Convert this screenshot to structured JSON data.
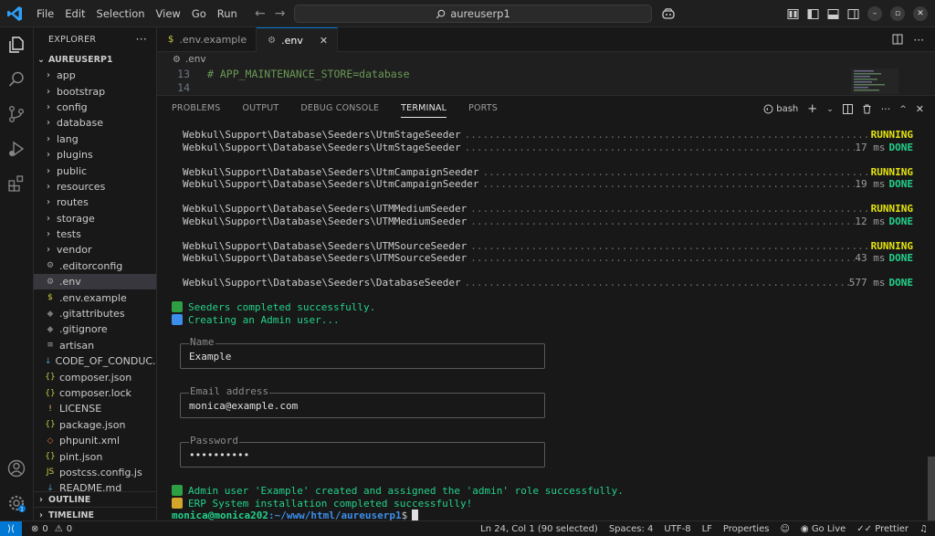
{
  "titlebar": {
    "menu": [
      "File",
      "Edit",
      "Selection",
      "View",
      "Go",
      "Run"
    ],
    "search": "aureuserp1"
  },
  "explorer": {
    "title": "EXPLORER",
    "more": "···",
    "root": "AUREUSERP1",
    "items": [
      {
        "label": "app",
        "type": "folder"
      },
      {
        "label": "bootstrap",
        "type": "folder"
      },
      {
        "label": "config",
        "type": "folder"
      },
      {
        "label": "database",
        "type": "folder"
      },
      {
        "label": "lang",
        "type": "folder"
      },
      {
        "label": "plugins",
        "type": "folder"
      },
      {
        "label": "public",
        "type": "folder"
      },
      {
        "label": "resources",
        "type": "folder"
      },
      {
        "label": "routes",
        "type": "folder"
      },
      {
        "label": "storage",
        "type": "folder"
      },
      {
        "label": "tests",
        "type": "folder"
      },
      {
        "label": "vendor",
        "type": "folder"
      },
      {
        "label": ".editorconfig",
        "type": "file",
        "icon": "⚙",
        "color": "#a0a0a0"
      },
      {
        "label": ".env",
        "type": "file",
        "icon": "⚙",
        "color": "#a0a0a0",
        "selected": true
      },
      {
        "label": ".env.example",
        "type": "file",
        "icon": "$",
        "color": "#cbcb41"
      },
      {
        "label": ".gitattributes",
        "type": "file",
        "icon": "◆",
        "color": "#7a7a7a"
      },
      {
        "label": ".gitignore",
        "type": "file",
        "icon": "◆",
        "color": "#7a7a7a"
      },
      {
        "label": "artisan",
        "type": "file",
        "icon": "≡",
        "color": "#a0a0a0"
      },
      {
        "label": "CODE_OF_CONDUC...",
        "type": "file",
        "icon": "↓",
        "color": "#519aba"
      },
      {
        "label": "composer.json",
        "type": "file",
        "icon": "{}",
        "color": "#cbcb41"
      },
      {
        "label": "composer.lock",
        "type": "file",
        "icon": "{}",
        "color": "#cbcb41"
      },
      {
        "label": "LICENSE",
        "type": "file",
        "icon": "!",
        "color": "#e5c07b"
      },
      {
        "label": "package.json",
        "type": "file",
        "icon": "{}",
        "color": "#cbcb41"
      },
      {
        "label": "phpunit.xml",
        "type": "file",
        "icon": "◇",
        "color": "#e37933"
      },
      {
        "label": "pint.json",
        "type": "file",
        "icon": "{}",
        "color": "#cbcb41"
      },
      {
        "label": "postcss.config.js",
        "type": "file",
        "icon": "JS",
        "color": "#cbcb41"
      },
      {
        "label": "README.md",
        "type": "file",
        "icon": "↓",
        "color": "#519aba"
      }
    ],
    "outline": "OUTLINE",
    "timeline": "TIMELINE"
  },
  "tabs": [
    {
      "label": ".env.example",
      "icon": "$",
      "active": false
    },
    {
      "label": ".env",
      "icon": "⚙",
      "active": true,
      "close": "✕"
    }
  ],
  "breadcrumb": ".env",
  "code": [
    {
      "line": "13",
      "text": "# APP_MAINTENANCE_STORE=database"
    },
    {
      "line": "14",
      "text": ""
    }
  ],
  "panel": {
    "tabs": [
      "PROBLEMS",
      "OUTPUT",
      "DEBUG CONSOLE",
      "TERMINAL",
      "PORTS"
    ],
    "active_tab": "TERMINAL",
    "shell": "bash"
  },
  "terminal": {
    "seeders": [
      {
        "name": "Webkul\\Support\\Database\\Seeders\\UtmStageSeeder",
        "time": "",
        "status": "RUNNING"
      },
      {
        "name": "Webkul\\Support\\Database\\Seeders\\UtmStageSeeder",
        "time": "17 ms",
        "status": "DONE"
      },
      {
        "name": "Webkul\\Support\\Database\\Seeders\\UtmCampaignSeeder",
        "time": "",
        "status": "RUNNING"
      },
      {
        "name": "Webkul\\Support\\Database\\Seeders\\UtmCampaignSeeder",
        "time": "19 ms",
        "status": "DONE"
      },
      {
        "name": "Webkul\\Support\\Database\\Seeders\\UTMMediumSeeder",
        "time": "",
        "status": "RUNNING"
      },
      {
        "name": "Webkul\\Support\\Database\\Seeders\\UTMMediumSeeder",
        "time": "12 ms",
        "status": "DONE"
      },
      {
        "name": "Webkul\\Support\\Database\\Seeders\\UTMSourceSeeder",
        "time": "",
        "status": "RUNNING"
      },
      {
        "name": "Webkul\\Support\\Database\\Seeders\\UTMSourceSeeder",
        "time": "43 ms",
        "status": "DONE"
      },
      {
        "name": "Webkul\\Support\\Database\\Seeders\\DatabaseSeeder",
        "time": "577 ms",
        "status": "DONE"
      }
    ],
    "seeders_done": "Seeders completed successfully.",
    "creating_admin": "Creating an Admin user...",
    "name_label": "Name",
    "name_value": "Example",
    "email_label": "Email address",
    "email_value": "monica@example.com",
    "password_label": "Password",
    "password_value": "••••••••••",
    "admin_created": "Admin user 'Example' created and assigned the 'admin' role successfully.",
    "install_done": "ERP System installation completed successfully!",
    "prompt_user": "monica@monica202",
    "prompt_path": ":~/www/html/aureuserp1",
    "prompt_suffix": "$"
  },
  "statusbar": {
    "errors": "0",
    "warnings": "0",
    "position": "Ln 24, Col 1 (90 selected)",
    "spaces": "Spaces: 4",
    "encoding": "UTF-8",
    "eol": "LF",
    "properties": "Properties",
    "golive": "Go Live",
    "prettier": "Prettier"
  }
}
